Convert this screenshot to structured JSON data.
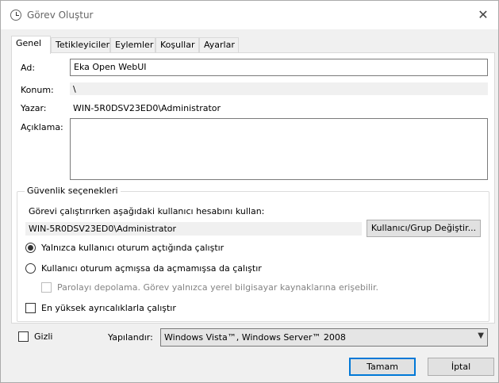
{
  "window": {
    "title": "Görev Oluştur",
    "close_glyph": "✕"
  },
  "tabs": [
    {
      "label": "Genel"
    },
    {
      "label": "Tetikleyiciler"
    },
    {
      "label": "Eylemler"
    },
    {
      "label": "Koşullar"
    },
    {
      "label": "Ayarlar"
    }
  ],
  "general": {
    "name_label": "Ad:",
    "name_value": "Eka Open WebUI",
    "location_label": "Konum:",
    "location_value": "\\",
    "author_label": "Yazar:",
    "author_value": "WIN-5R0DSV23ED0\\Administrator",
    "description_label": "Açıklama:",
    "description_value": ""
  },
  "security": {
    "group_title": "Güvenlik seçenekleri",
    "run_as_label": "Görevi çalıştırırken aşağıdaki kullanıcı hesabını kullan:",
    "run_as_value": "WIN-5R0DSV23ED0\\Administrator",
    "change_user_button": "Kullanıcı/Grup Değiştir...",
    "option_logged_on": "Yalnızca kullanıcı oturum açtığında çalıştır",
    "option_whether_logged": "Kullanıcı oturum açmışsa da açmamışsa da çalıştır",
    "option_no_password": "Parolayı depolama. Görev yalnızca yerel bilgisayar kaynaklarına erişebilir.",
    "highest_privileges": "En yüksek ayrıcalıklarla çalıştır",
    "selected_option": "logged_on"
  },
  "footer": {
    "hidden_label": "Gizli",
    "configure_label": "Yapılandır:",
    "configure_value": "Windows Vista™, Windows Server™ 2008",
    "ok_button": "Tamam",
    "cancel_button": "İptal"
  }
}
